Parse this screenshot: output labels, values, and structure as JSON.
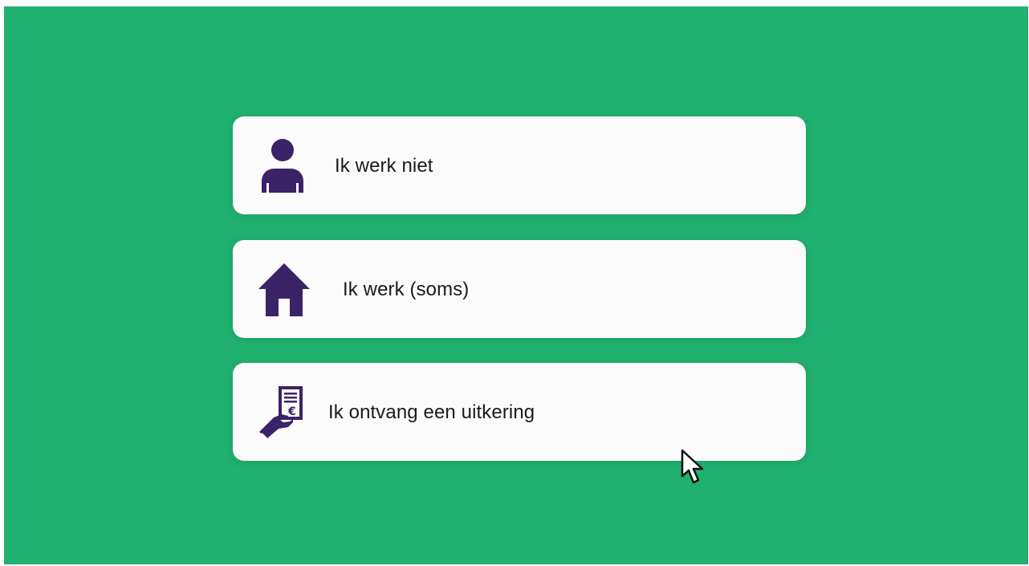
{
  "colors": {
    "background": "#20b06f",
    "card": "#fbfbfb",
    "icon": "#3b2367",
    "text": "#1a1a1a"
  },
  "options": [
    {
      "label": "Ik werk niet",
      "icon": "person-icon"
    },
    {
      "label": "Ik werk (soms)",
      "icon": "house-icon"
    },
    {
      "label": "Ik ontvang een uitkering",
      "icon": "benefit-document-icon"
    }
  ],
  "pointer": {
    "icon": "mouse-pointer-icon"
  }
}
